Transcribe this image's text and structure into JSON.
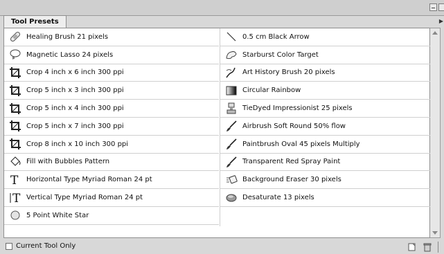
{
  "panel": {
    "tab_label": "Tool Presets"
  },
  "presets": {
    "left": [
      {
        "label": "Healing Brush 21 pixels",
        "icon": "healing-brush-icon"
      },
      {
        "label": "Magnetic Lasso 24 pixels",
        "icon": "magnetic-lasso-icon"
      },
      {
        "label": "Crop 4 inch x 6 inch 300 ppi",
        "icon": "crop-icon"
      },
      {
        "label": "Crop 5 inch x 3 inch 300 ppi",
        "icon": "crop-icon"
      },
      {
        "label": "Crop 5 inch x 4 inch 300 ppi",
        "icon": "crop-icon"
      },
      {
        "label": "Crop 5 inch x 7 inch 300 ppi",
        "icon": "crop-icon"
      },
      {
        "label": "Crop 8 inch x 10 inch 300 ppi",
        "icon": "crop-icon"
      },
      {
        "label": "Fill with Bubbles Pattern",
        "icon": "paint-bucket-icon"
      },
      {
        "label": "Horizontal Type Myriad Roman 24 pt",
        "icon": "horizontal-type-icon"
      },
      {
        "label": "Vertical Type Myriad Roman 24 pt",
        "icon": "vertical-type-icon"
      },
      {
        "label": "5 Point White Star",
        "icon": "ellipse-shape-icon"
      }
    ],
    "right": [
      {
        "label": "0.5 cm Black Arrow",
        "icon": "line-tool-icon"
      },
      {
        "label": "Starburst Color Target",
        "icon": "custom-shape-icon"
      },
      {
        "label": "Art History Brush 20 pixels",
        "icon": "art-history-brush-icon"
      },
      {
        "label": "Circular Rainbow",
        "icon": "gradient-icon"
      },
      {
        "label": "TieDyed Impressionist 25 pixels",
        "icon": "pattern-stamp-icon"
      },
      {
        "label": "Airbrush Soft Round 50% flow",
        "icon": "brush-icon"
      },
      {
        "label": "Paintbrush Oval 45 pixels Multiply",
        "icon": "brush-icon"
      },
      {
        "label": "Transparent Red Spray Paint",
        "icon": "brush-icon"
      },
      {
        "label": "Background Eraser 30 pixels",
        "icon": "background-eraser-icon"
      },
      {
        "label": "Desaturate 13 pixels",
        "icon": "sponge-icon"
      }
    ]
  },
  "footer": {
    "current_tool_only_label": "Current Tool Only",
    "current_tool_only_checked": false
  }
}
